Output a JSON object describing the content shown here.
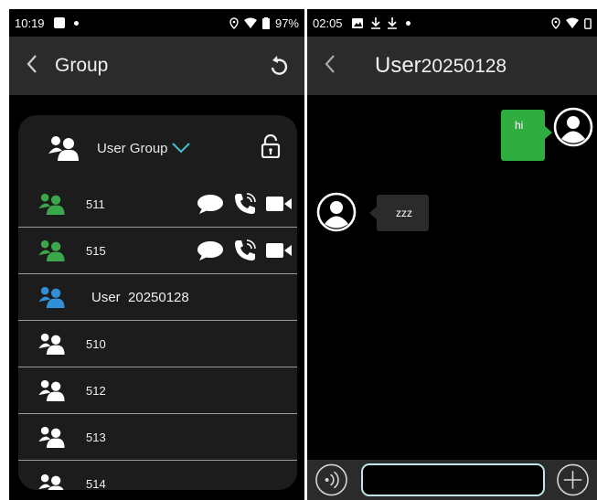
{
  "left": {
    "status": {
      "time": "10:19",
      "battery": "97%"
    },
    "header": {
      "back_icon": "chevron-left-icon",
      "title": "Group",
      "refresh_icon": "refresh-icon"
    },
    "group": {
      "name": "User Group",
      "icon": "group-icon",
      "lock_icon": "lock-open-icon",
      "members": [
        {
          "label": "511",
          "color": "#3aa84a",
          "actions": true
        },
        {
          "label": "515",
          "color": "#3aa84a",
          "actions": true
        },
        {
          "label": "User  20250128",
          "color": "#2f8fd8",
          "actions": false
        },
        {
          "label": "510",
          "color": "#ffffff",
          "actions": false
        },
        {
          "label": "512",
          "color": "#ffffff",
          "actions": false
        },
        {
          "label": "513",
          "color": "#ffffff",
          "actions": false
        },
        {
          "label": "514",
          "color": "#ffffff",
          "actions": false
        }
      ]
    }
  },
  "right": {
    "status": {
      "time": "02:05"
    },
    "header": {
      "back_icon": "chevron-left-icon",
      "title_main": "User",
      "title_suffix": "20250128"
    },
    "messages": [
      {
        "direction": "out",
        "text": "hi",
        "color": "#2fae3f"
      },
      {
        "direction": "in",
        "text": "zzz",
        "color": "#2b2b2b"
      }
    ],
    "input": {
      "value": "",
      "placeholder": ""
    }
  }
}
